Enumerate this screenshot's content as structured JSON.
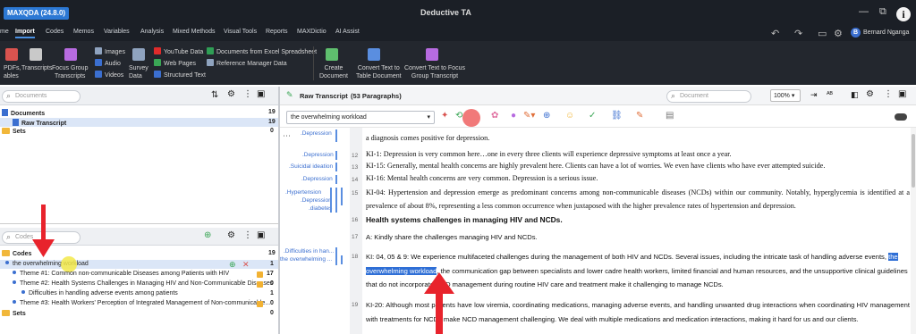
{
  "app": {
    "badge": "MAXQDA (24.8.0)",
    "window_title": "Deductive TA"
  },
  "menu": [
    "me",
    "Import",
    "Codes",
    "Memos",
    "Variables",
    "Analysis",
    "Mixed Methods",
    "Visual Tools",
    "Reports",
    "MAXDictio",
    "AI Assist"
  ],
  "user": {
    "initial": "B",
    "name": "Bernard Nganga"
  },
  "ribbon": {
    "pdfs": "PDFs,",
    "pdfs2": "ables",
    "transcripts": "Transcripts",
    "focus_group": "Focus Group",
    "focus_group2": "Transcripts",
    "images": "Images",
    "audio": "Audio",
    "videos": "Videos",
    "survey": "Survey",
    "survey2": "Data",
    "youtube": "YouTube Data",
    "webpages": "Web Pages",
    "structured": "Structured Text",
    "excel": "Documents from Excel Spreadsheet",
    "refmgr": "Reference Manager Data",
    "create": "Create",
    "create2": "Document",
    "convert_table": "Convert Text to",
    "convert_table2": "Table Document",
    "convert_focus": "Convert Text to Focus",
    "convert_focus2": "Group Transcript"
  },
  "documents_panel": {
    "search_placeholder": "Documents",
    "root": "Documents",
    "root_count": "19",
    "doc": "Raw Transcript",
    "doc_count": "19",
    "sets": "Sets",
    "sets_count": "0"
  },
  "codes_panel": {
    "search_placeholder": "Codes",
    "root": "Codes",
    "root_count": "19",
    "items": [
      {
        "label": "the overwhelming workload",
        "count": "1"
      },
      {
        "label": "Theme #1: Common non-communicable Diseases among Patients with HIV",
        "count": "17"
      },
      {
        "label": "Theme #2: Health Systems Challenges in Managing HIV  and Non-Communicable Diseases",
        "count": "0"
      },
      {
        "label": "Difficulties in handling adverse events among patients",
        "count": "1"
      },
      {
        "label": "Theme #3: Health Workers' Perception of Integrated Management of Non-communicable...",
        "count": "0"
      }
    ],
    "sets": "Sets",
    "sets_count": "0"
  },
  "document_view": {
    "title": "Raw Transcript",
    "paragraphs": "(53 Paragraphs)",
    "search_placeholder": "Document",
    "zoom": "100%",
    "code_selector": "the overwhelming workload",
    "margin_codes": [
      ".Depression",
      ".Depression",
      ".Suicidal ideation",
      ".Depression",
      ".Hypertension",
      ".Depression",
      ".diabetes",
      ".Difficulties in han...",
      "the overwhelming ..."
    ],
    "lines": [
      {
        "num": "",
        "text": "a diagnosis comes positive for depression."
      },
      {
        "num": "12",
        "text": "KI-1: Depression is very common here…one in every three clients will experience depressive symptoms at least once a year."
      },
      {
        "num": "13",
        "text": "KI-15: Generally, mental health concerns are highly prevalent here. Clients can have a lot of worries. We even have clients who have ever attempted suicide."
      },
      {
        "num": "14",
        "text": "KI-16: Mental health concerns are very common. Depression is a serious issue."
      },
      {
        "num": "15",
        "text": "KI-04: Hypertension and depression emerge as predominant concerns among non-communicable diseases (NCDs) within our community. Notably, hyperglycemia is identified at a prevalence of about 8%, representing a less common occurrence when juxtaposed with the higher prevalence rates of hypertension and depression."
      },
      {
        "num": "16",
        "text": "Health systems challenges in managing HIV  and NCDs."
      },
      {
        "num": "17",
        "text": "A: Kindly share the challenges managing HIV and NCDs."
      },
      {
        "num": "18",
        "text_before": "KI: 04, 05 & 9: We experience multifaceted challenges during the management of both HIV and NCDs. Several issues, including the intricate task of handling adverse events, ",
        "text_highlight": "the overwhelming workload",
        "text_after": ", the communication gap between specialists and lower cadre health workers, limited financial and human resources, and the unsupportive clinical guidelines that do not incorporate NCD management during routine HIV care and treatment make it challenging to manage NCDs."
      },
      {
        "num": "19",
        "text": "KI-20: Although most patients have low viremia, coordinating medications, managing adverse events, and handling unwanted drug interactions when coordinating HIV management with treatments for NCDs make NCD management challenging. We deal with multiple medications and medication interactions, making it hard for us and our clients."
      }
    ]
  },
  "colors": {
    "titlebar": "#1b1f26",
    "ribbon": "#23272e",
    "accent": "#2f6fd6",
    "arrow": "#e8232c",
    "highlight_pointer": "#f3e94a"
  },
  "icons": [
    "search-icon",
    "gear-icon",
    "filter-icon",
    "close-icon",
    "undo-icon",
    "redo-icon",
    "info-icon",
    "folder-icon",
    "document-icon",
    "memo-icon"
  ]
}
